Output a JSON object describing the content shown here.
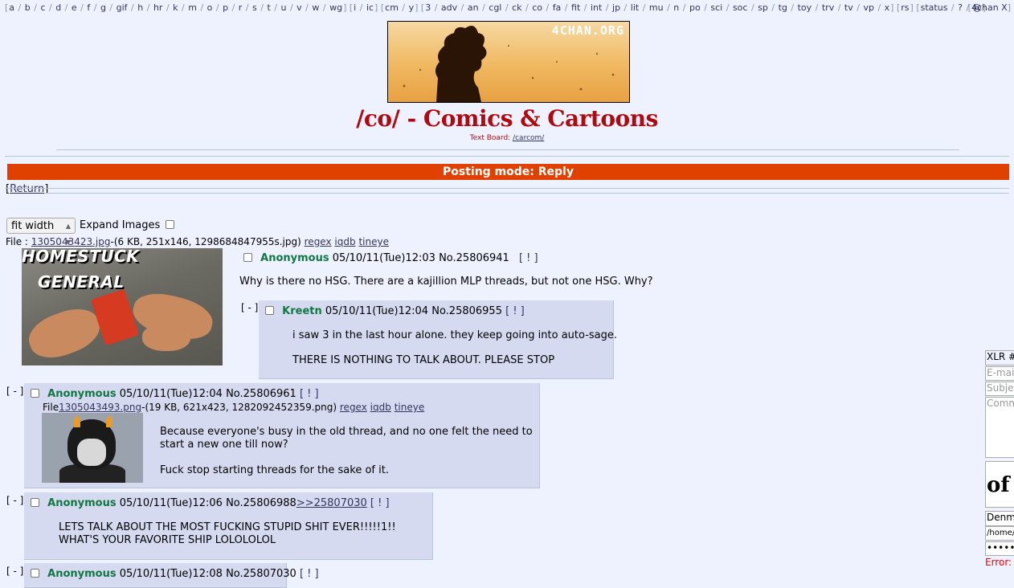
{
  "nav": {
    "boards": [
      "a",
      "b",
      "c",
      "d",
      "e",
      "f",
      "g",
      "gif",
      "h",
      "hr",
      "k",
      "m",
      "o",
      "p",
      "r",
      "s",
      "t",
      "u",
      "v",
      "w",
      "wg"
    ],
    "boards2": [
      "i",
      "ic"
    ],
    "boards3": [
      "cm",
      "y"
    ],
    "boards4": [
      "3",
      "adv",
      "an",
      "cgl",
      "ck",
      "co",
      "fa",
      "fit",
      "int",
      "jp",
      "lit",
      "mu",
      "n",
      "po",
      "sci",
      "soc",
      "sp",
      "tg",
      "toy",
      "trv",
      "tv",
      "vp",
      "x"
    ],
    "boards5": [
      "rs"
    ],
    "boards6": [
      "status",
      "?",
      "@"
    ],
    "right_label": "4chan X"
  },
  "banner": {
    "logo_text": "4CHAN.ORG"
  },
  "board_title": "/co/ - Comics & Cartoons",
  "textboard": {
    "label": "Text Board:",
    "link": "/carcom/"
  },
  "posting_mode": "Posting mode: Reply",
  "return_link": "Return",
  "image_fit": {
    "selected": "fit width",
    "expand_label": "Expand Images"
  },
  "op": {
    "file_prefix": "File :",
    "file_name": "1305043423.jpg",
    "file_meta": "-(6 KB, 251x146, 1298684847955s.jpg)",
    "image_text_line1": "HOMESTUCK",
    "image_text_line2": "GENERAL",
    "name": "Anonymous",
    "datetime": "05/10/11(Tue)12:03",
    "post_no": "No.25806941",
    "report": "[ ! ]",
    "comment": "Why is there no HSG. There are a kajillion MLP threads, but not one HSG. Why?"
  },
  "links": {
    "regex": "regex",
    "iqdb": "iqdb",
    "tineye": "tineye"
  },
  "replies": [
    {
      "toggle": "[ - ]",
      "name": "Kreetn",
      "datetime": "05/10/11(Tue)12:04",
      "post_no": "No.25806955",
      "report": "[ ! ]",
      "lines": [
        "i saw 3 in the last hour alone. they keep going into auto-sage.",
        "THERE IS NOTHING TO TALK ABOUT. PLEASE STOP"
      ]
    },
    {
      "toggle": "[ - ]",
      "name": "Anonymous",
      "datetime": "05/10/11(Tue)12:04",
      "post_no": "No.25806961",
      "report": "[ ! ]",
      "file_prefix": "File",
      "file_name": "1305043493.png",
      "file_meta": "-(19 KB, 621x423, 1282092452359.png)",
      "lines": [
        "Because everyone's busy in the old thread, and no one felt the need to",
        "start a new one till now?",
        "Fuck stop starting threads for the sake of it."
      ]
    },
    {
      "toggle": "[ - ]",
      "name": "Anonymous",
      "datetime": "05/10/11(Tue)12:06",
      "post_no": "No.25806988",
      "backlink": ">>25807030",
      "report": "[ ! ]",
      "lines": [
        "LETS TALK ABOUT THE MOST FUCKING STUPID SHIT EVER!!!!!1!!",
        "WHAT'S YOUR FAVORITE SHIP LOLOLOLOL"
      ]
    },
    {
      "toggle": "[ - ]",
      "name": "Anonymous",
      "datetime": "05/10/11(Tue)12:08",
      "post_no": "No.25807030",
      "report": "[ ! ]"
    }
  ],
  "sidebar": {
    "header": "XLR #",
    "email_placeholder": "E-mail",
    "subject_placeholder": "Subject",
    "comment_placeholder": "Comment",
    "captcha_text": "of",
    "captcha_answer": "Denm",
    "file_path": "/home/",
    "password": "•••••",
    "error": "Error:"
  },
  "colors": {
    "accent": "#af0a0f",
    "name": "#117743",
    "reply_bg": "#d6daf0",
    "banner_bar": "#e04000"
  }
}
